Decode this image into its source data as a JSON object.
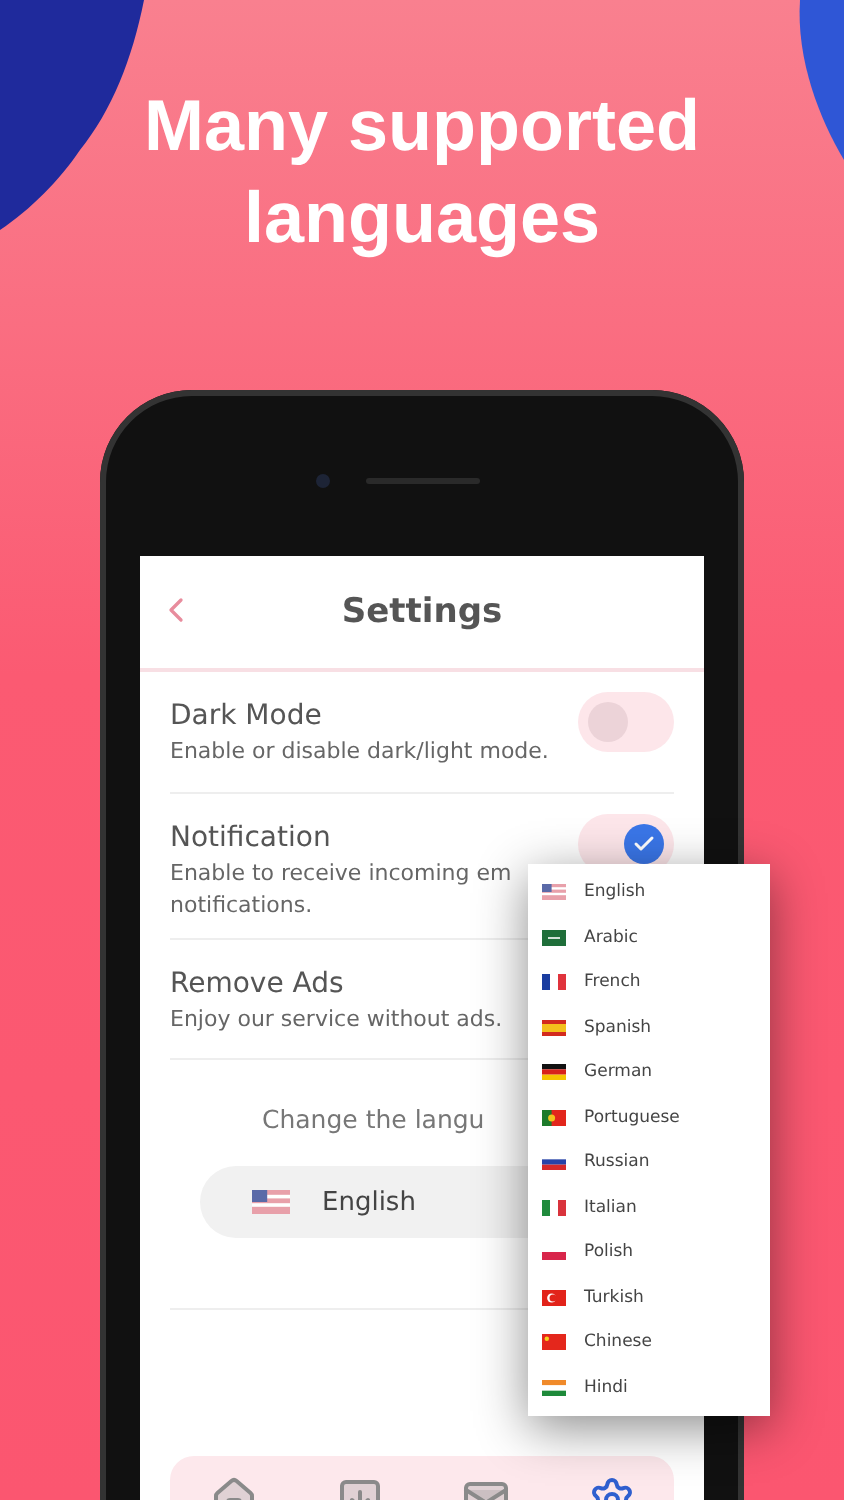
{
  "headline": "Many supported languages",
  "screen": {
    "title": "Settings",
    "settings": [
      {
        "kind": "toggle",
        "title": "Dark Mode",
        "description_lines": [
          "Enable or disable dark/light mode."
        ],
        "on": false
      },
      {
        "kind": "toggle",
        "title": "Notification",
        "description_lines": [
          "Enable to receive incoming em",
          "notifications."
        ],
        "on": true
      },
      {
        "kind": "plain",
        "title": "Remove Ads",
        "description_lines": [
          "Enjoy our service without ads."
        ]
      }
    ],
    "language_section": {
      "label": "Change the langu",
      "current": "English"
    },
    "nav": [
      {
        "selected": false
      },
      {
        "selected": false
      },
      {
        "selected": false
      },
      {
        "selected": true
      }
    ]
  },
  "language_menu": [
    {
      "label": "English"
    },
    {
      "label": "Arabic"
    },
    {
      "label": "French"
    },
    {
      "label": "Spanish"
    },
    {
      "label": "German"
    },
    {
      "label": "Portuguese"
    },
    {
      "label": "Russian"
    },
    {
      "label": "Italian"
    },
    {
      "label": "Polish"
    },
    {
      "label": "Turkish"
    },
    {
      "label": "Chinese"
    },
    {
      "label": "Hindi"
    }
  ]
}
